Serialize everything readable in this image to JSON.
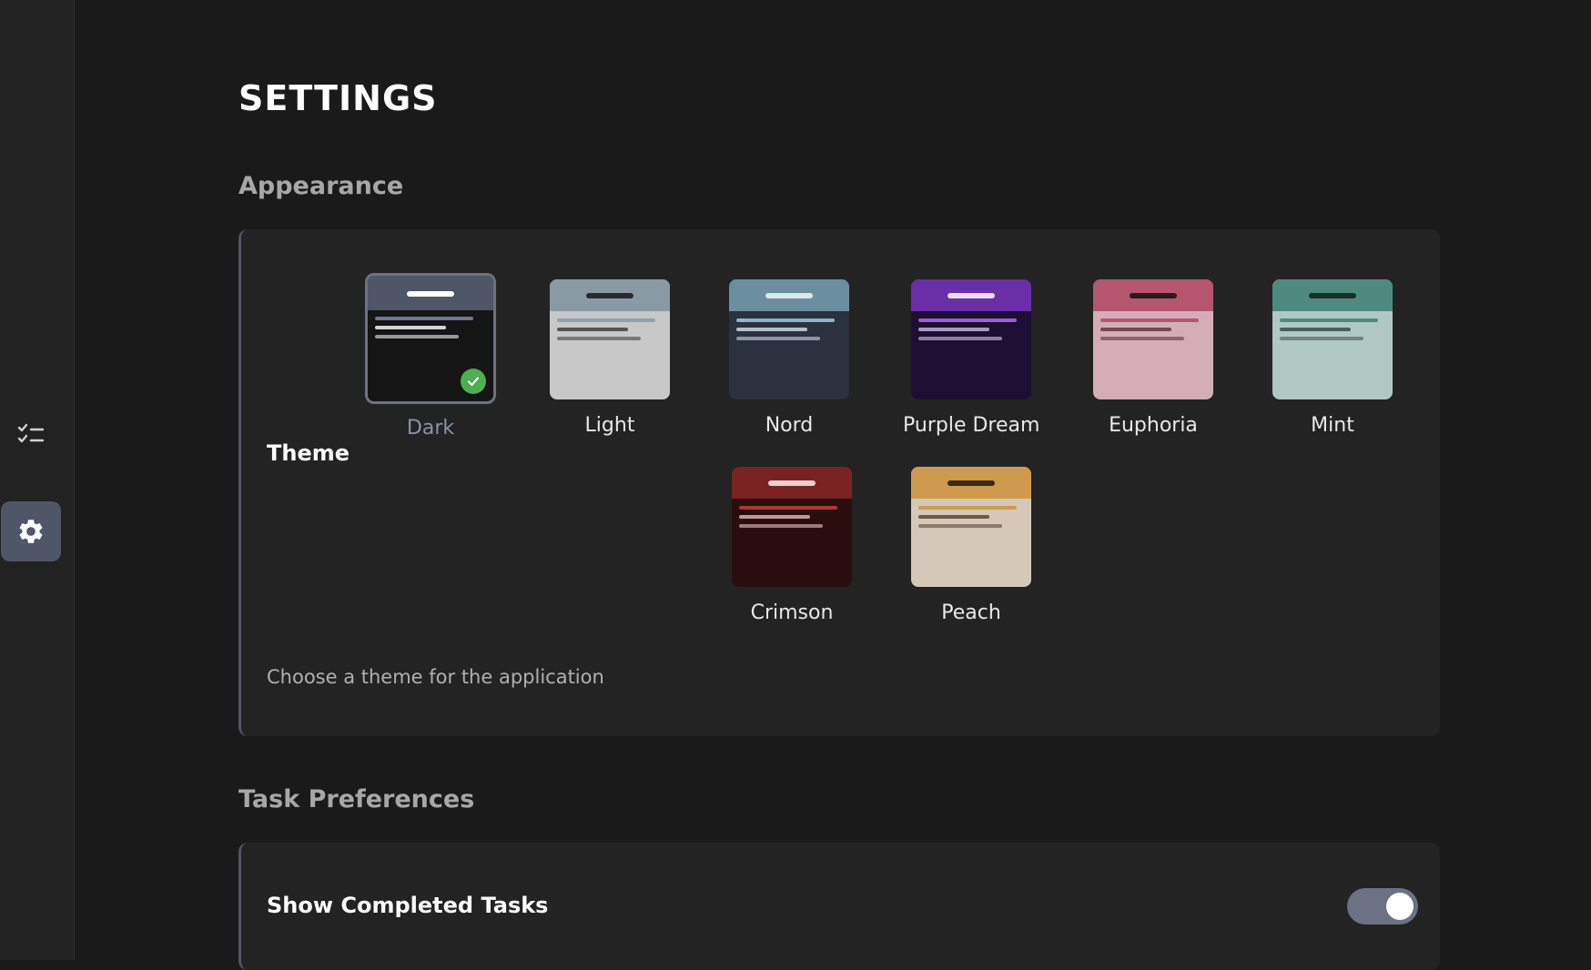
{
  "page": {
    "title": "SETTINGS"
  },
  "nav": {
    "items": [
      {
        "icon": "tasks-list-icon",
        "active": false
      },
      {
        "icon": "gear-icon",
        "active": true
      }
    ]
  },
  "appearance": {
    "section_title": "Appearance",
    "theme_label": "Theme",
    "description": "Choose a theme for the application",
    "selected": "Dark",
    "themes": [
      {
        "name": "Dark",
        "header": "#4f5668",
        "header_line": "#ffffff",
        "body": "#151515",
        "lines": [
          "#6f7890",
          "#d4d4d4",
          "#9a9a9a"
        ]
      },
      {
        "name": "Light",
        "header": "#8a9aa5",
        "header_line": "#2b2b2b",
        "body": "#c8c8c8",
        "lines": [
          "#8aa3b5",
          "#555555",
          "#777777"
        ]
      },
      {
        "name": "Nord",
        "header": "#6b8fa0",
        "header_line": "#e0e6ea",
        "body": "#2b313e",
        "lines": [
          "#8fb3c8",
          "#b5bfcc",
          "#8a96a8"
        ]
      },
      {
        "name": "Purple Dream",
        "header": "#6a2fa8",
        "header_line": "#e6dcf5",
        "body": "#1c0f33",
        "lines": [
          "#9a5ed8",
          "#a99cc2",
          "#8a80a5"
        ]
      },
      {
        "name": "Euphoria",
        "header": "#b5566e",
        "header_line": "#2b1a20",
        "body": "#d4adb9",
        "lines": [
          "#b5566e",
          "#6e4a54",
          "#8a6670"
        ]
      },
      {
        "name": "Mint",
        "header": "#4f8a80",
        "header_line": "#1f2d2a",
        "body": "#b0c8c4",
        "lines": [
          "#4f8a80",
          "#4a5e5a",
          "#6e8480"
        ]
      },
      {
        "name": "Crimson",
        "header": "#7a2222",
        "header_line": "#e8d0d0",
        "body": "#2a0e0e",
        "lines": [
          "#b03434",
          "#c09a9a",
          "#a07a7a"
        ]
      },
      {
        "name": "Peach",
        "header": "#cf9a4e",
        "header_line": "#3a2a18",
        "body": "#d4c8b8",
        "lines": [
          "#cf9a4e",
          "#6a5a48",
          "#8a7a68"
        ]
      }
    ]
  },
  "task_preferences": {
    "section_title": "Task Preferences",
    "show_completed_label": "Show Completed Tasks",
    "show_completed": true
  }
}
